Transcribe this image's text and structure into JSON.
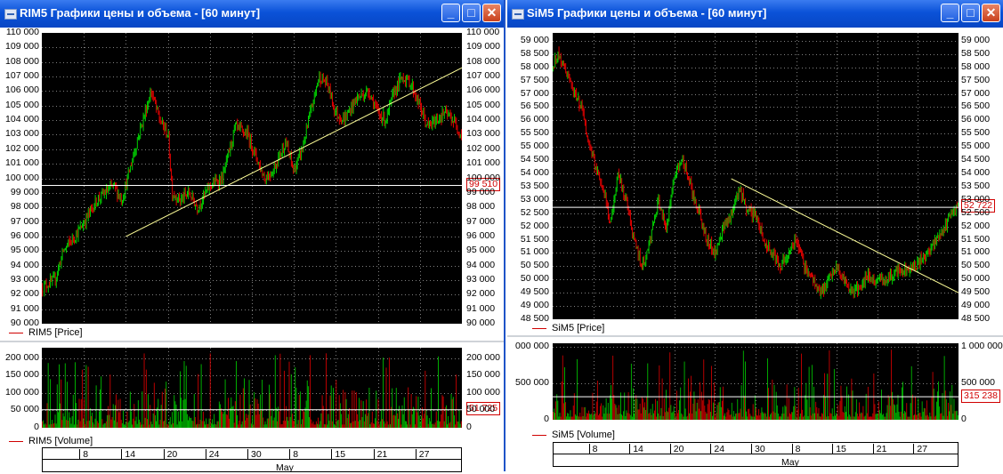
{
  "windows": [
    {
      "id": "left",
      "title": "RIM5 Графики цены и объема - [60 минут]",
      "price": {
        "ticks": [
          "110 000",
          "109 000",
          "108 000",
          "107 000",
          "106 000",
          "105 000",
          "104 000",
          "103 000",
          "102 000",
          "101 000",
          "100 000",
          "99 000",
          "98 000",
          "97 000",
          "96 000",
          "95 000",
          "94 000",
          "93 000",
          "92 000",
          "91 000",
          "90 000"
        ],
        "range": [
          90000,
          110000
        ],
        "last_value": "99 510",
        "last": 99510,
        "legend": "RIM5 [Price]",
        "trendline": {
          "from": [
            0.2,
            96000
          ],
          "to": [
            1.0,
            107600
          ]
        },
        "anchors": [
          [
            0,
            92500
          ],
          [
            0.03,
            93000
          ],
          [
            0.05,
            95000
          ],
          [
            0.09,
            96500
          ],
          [
            0.13,
            98500
          ],
          [
            0.17,
            99500
          ],
          [
            0.19,
            98500
          ],
          [
            0.23,
            103000
          ],
          [
            0.26,
            106000
          ],
          [
            0.28,
            104000
          ],
          [
            0.3,
            103000
          ],
          [
            0.31,
            99000
          ],
          [
            0.33,
            98500
          ],
          [
            0.35,
            99000
          ],
          [
            0.37,
            98000
          ],
          [
            0.4,
            99500
          ],
          [
            0.43,
            100000
          ],
          [
            0.46,
            103500
          ],
          [
            0.49,
            103000
          ],
          [
            0.51,
            101500
          ],
          [
            0.53,
            100000
          ],
          [
            0.55,
            100500
          ],
          [
            0.58,
            102500
          ],
          [
            0.6,
            100500
          ],
          [
            0.62,
            102000
          ],
          [
            0.64,
            104500
          ],
          [
            0.66,
            107000
          ],
          [
            0.68,
            106500
          ],
          [
            0.7,
            104500
          ],
          [
            0.72,
            104000
          ],
          [
            0.75,
            105500
          ],
          [
            0.78,
            106000
          ],
          [
            0.8,
            104500
          ],
          [
            0.82,
            104000
          ],
          [
            0.84,
            106000
          ],
          [
            0.86,
            107000
          ],
          [
            0.88,
            106500
          ],
          [
            0.9,
            105000
          ],
          [
            0.92,
            103500
          ],
          [
            0.94,
            104000
          ],
          [
            0.96,
            104500
          ],
          [
            0.98,
            104000
          ],
          [
            1.0,
            103000
          ]
        ]
      },
      "volume": {
        "ticks": [
          "200 000",
          "150 000",
          "100 000",
          "50 000",
          "0"
        ],
        "range": [
          0,
          230000
        ],
        "last_value": "51 725",
        "last": 51725,
        "legend": "RIM5 [Volume]"
      },
      "xaxis": {
        "days": [
          "8",
          "14",
          "20",
          "24",
          "30",
          "8",
          "15",
          "21",
          "27"
        ],
        "month": "May"
      }
    },
    {
      "id": "right",
      "title": "SiM5 Графики цены и объема - [60 минут]",
      "price": {
        "ticks": [
          "59 000",
          "58 500",
          "58 000",
          "57 500",
          "57 000",
          "56 500",
          "56 000",
          "55 500",
          "55 000",
          "54 500",
          "54 000",
          "53 500",
          "53 000",
          "52 500",
          "52 000",
          "51 500",
          "51 000",
          "50 500",
          "50 000",
          "49 500",
          "49 000",
          "48 500"
        ],
        "range": [
          48500,
          59300
        ],
        "last_value": "52 722",
        "last": 52722,
        "legend": "SiM5 [Price]",
        "trendline": {
          "from": [
            0.44,
            53800
          ],
          "to": [
            1.0,
            49500
          ]
        },
        "anchors": [
          [
            0,
            58000
          ],
          [
            0.01,
            58500
          ],
          [
            0.03,
            58000
          ],
          [
            0.05,
            57000
          ],
          [
            0.07,
            56500
          ],
          [
            0.09,
            55000
          ],
          [
            0.11,
            54000
          ],
          [
            0.13,
            53000
          ],
          [
            0.14,
            52000
          ],
          [
            0.16,
            54000
          ],
          [
            0.18,
            53000
          ],
          [
            0.2,
            51500
          ],
          [
            0.22,
            50500
          ],
          [
            0.24,
            51500
          ],
          [
            0.26,
            53000
          ],
          [
            0.28,
            52000
          ],
          [
            0.3,
            54000
          ],
          [
            0.32,
            54500
          ],
          [
            0.34,
            53500
          ],
          [
            0.36,
            52500
          ],
          [
            0.38,
            51500
          ],
          [
            0.4,
            51000
          ],
          [
            0.42,
            52000
          ],
          [
            0.44,
            52500
          ],
          [
            0.46,
            53500
          ],
          [
            0.48,
            52500
          ],
          [
            0.5,
            52500
          ],
          [
            0.52,
            51500
          ],
          [
            0.54,
            51000
          ],
          [
            0.56,
            50500
          ],
          [
            0.58,
            51000
          ],
          [
            0.6,
            51500
          ],
          [
            0.62,
            50500
          ],
          [
            0.64,
            50000
          ],
          [
            0.66,
            49500
          ],
          [
            0.68,
            50000
          ],
          [
            0.7,
            50500
          ],
          [
            0.72,
            50000
          ],
          [
            0.74,
            49500
          ],
          [
            0.76,
            49800
          ],
          [
            0.78,
            50200
          ],
          [
            0.8,
            49900
          ],
          [
            0.82,
            50000
          ],
          [
            0.84,
            50200
          ],
          [
            0.86,
            50300
          ],
          [
            0.88,
            50400
          ],
          [
            0.9,
            50600
          ],
          [
            0.92,
            50900
          ],
          [
            0.94,
            51300
          ],
          [
            0.96,
            51800
          ],
          [
            0.98,
            52400
          ],
          [
            1.0,
            52800
          ]
        ]
      },
      "volume": {
        "ticks_left": [
          "000 000",
          "500 000",
          "0"
        ],
        "ticks_right": [
          "1 000 000",
          "500 000",
          "0"
        ],
        "range": [
          0,
          1050000
        ],
        "last_value": "315 238",
        "last": 315238,
        "legend": "SiM5 [Volume]"
      },
      "xaxis": {
        "days": [
          "8",
          "14",
          "20",
          "24",
          "30",
          "8",
          "15",
          "21",
          "27"
        ],
        "month": "May"
      }
    }
  ],
  "buttons": {
    "minimize": "_",
    "maximize": "□",
    "close": "✕"
  },
  "colors": {
    "up": "#00d000",
    "down": "#e00000",
    "grid": "#808080",
    "trend": "#ffff99",
    "lastline": "#ffffff"
  }
}
